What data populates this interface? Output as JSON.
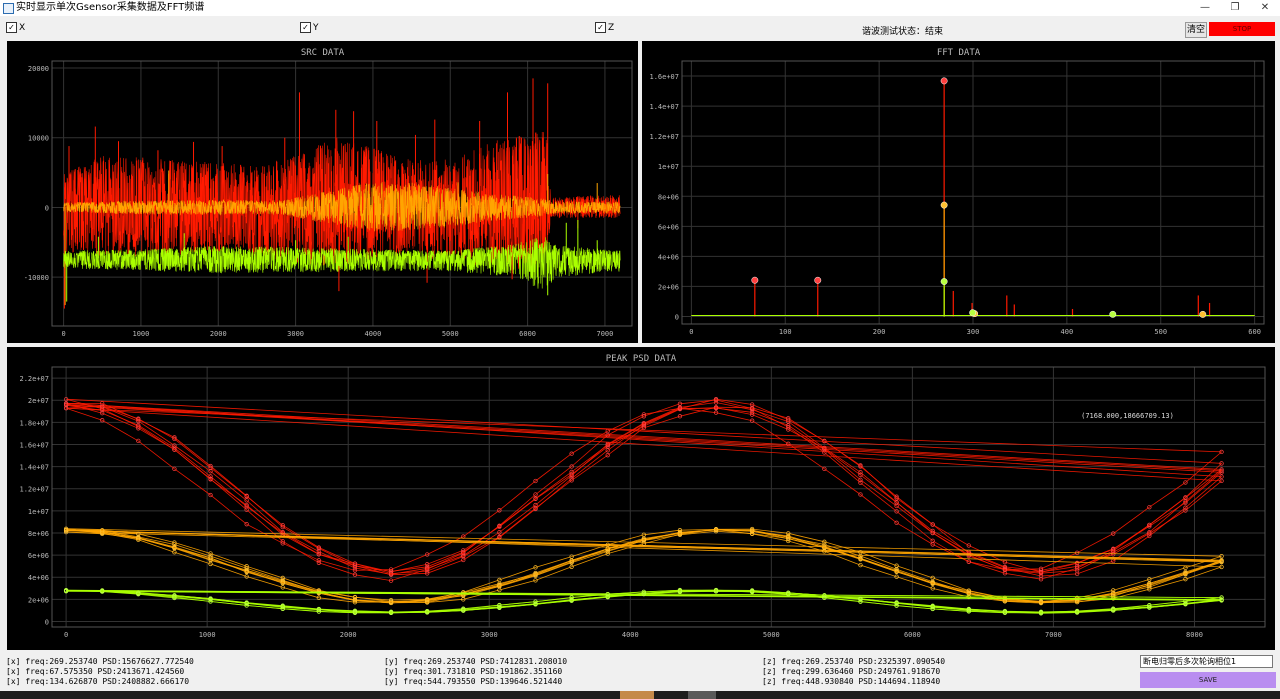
{
  "window": {
    "title": "实时显示单次Gsensor采集数据及FFT频谱"
  },
  "toolbar": {
    "checkboxes": [
      {
        "label": "X",
        "checked": true
      },
      {
        "label": "Y",
        "checked": true
      },
      {
        "label": "Z",
        "checked": true
      }
    ],
    "check_mark": "✓",
    "status_text": "谐波测试状态：结束",
    "clear_label": "清空",
    "stop_label": "STOP"
  },
  "colors": {
    "x": "#ff1a00",
    "y": "#ffa500",
    "z": "#aaff00",
    "panel_bg": "#000000",
    "grid": "#333333",
    "axis_text": "#bbbbbb",
    "x_marker": "#ff4040",
    "y_marker": "#ffc030",
    "z_marker": "#b8ff40",
    "stop": "#ff0000",
    "save": "#b98ef0"
  },
  "chart_data": [
    {
      "id": "src",
      "type": "line",
      "title": "SRC DATA",
      "xlim": [
        -150,
        7350
      ],
      "ylim": [
        -17000,
        21000
      ],
      "xticks": [
        0,
        1000,
        2000,
        3000,
        4000,
        5000,
        6000,
        7000
      ],
      "yticks": [
        -10000,
        0,
        10000,
        20000
      ],
      "ytick_labels": [
        "-10000",
        "0",
        "10000",
        "20000"
      ],
      "n_samples": 7200,
      "series": [
        {
          "key": "x",
          "center": 0,
          "cut_x": 6250,
          "upper_profile": [
            [
              0,
              4800
            ],
            [
              500,
              7500
            ],
            [
              1000,
              7200
            ],
            [
              1500,
              6800
            ],
            [
              2000,
              6400
            ],
            [
              2500,
              6000
            ],
            [
              3000,
              7400
            ],
            [
              3500,
              10200
            ],
            [
              4000,
              8600
            ],
            [
              4500,
              6800
            ],
            [
              5000,
              7000
            ],
            [
              5500,
              9300
            ],
            [
              6000,
              10800
            ],
            [
              6250,
              11200
            ],
            [
              6300,
              1500
            ],
            [
              7200,
              1800
            ]
          ],
          "lower_profile": [
            [
              0,
              -6500
            ],
            [
              500,
              -7000
            ],
            [
              1000,
              -7000
            ],
            [
              1500,
              -6800
            ],
            [
              2000,
              -6500
            ],
            [
              2500,
              -7000
            ],
            [
              3000,
              -8000
            ],
            [
              3500,
              -8500
            ],
            [
              4000,
              -7500
            ],
            [
              4500,
              -7200
            ],
            [
              5000,
              -7800
            ],
            [
              5500,
              -8500
            ],
            [
              6000,
              -9000
            ],
            [
              6250,
              -7000
            ],
            [
              6300,
              -1500
            ],
            [
              7200,
              -1500
            ]
          ],
          "spikes": [
            [
              10,
              -14500
            ],
            [
              70,
              8800
            ],
            [
              150,
              5500
            ],
            [
              410,
              11600
            ],
            [
              710,
              9500
            ],
            [
              1220,
              8200
            ],
            [
              1680,
              9400
            ],
            [
              2050,
              8800
            ],
            [
              2860,
              10000
            ],
            [
              3050,
              16500
            ],
            [
              3520,
              14000
            ],
            [
              3750,
              13800
            ],
            [
              4050,
              12400
            ],
            [
              4550,
              10400
            ],
            [
              4800,
              12600
            ],
            [
              5380,
              12400
            ],
            [
              5600,
              9200
            ],
            [
              5740,
              16500
            ],
            [
              5920,
              10000
            ],
            [
              6070,
              18500
            ],
            [
              6260,
              17800
            ],
            [
              6650,
              -3000
            ],
            [
              3560,
              -12000
            ],
            [
              4700,
              -10800
            ],
            [
              5800,
              -10300
            ]
          ]
        },
        {
          "key": "y",
          "center": 0,
          "upper_profile": [
            [
              0,
              700
            ],
            [
              1000,
              1000
            ],
            [
              2000,
              1100
            ],
            [
              2800,
              1000
            ],
            [
              3500,
              2600
            ],
            [
              4000,
              3700
            ],
            [
              4500,
              3600
            ],
            [
              5000,
              2900
            ],
            [
              5500,
              2000
            ],
            [
              6000,
              1500
            ],
            [
              6250,
              1200
            ],
            [
              6300,
              900
            ],
            [
              7200,
              800
            ]
          ],
          "lower_profile": [
            [
              0,
              -700
            ],
            [
              1000,
              -1000
            ],
            [
              2000,
              -1100
            ],
            [
              2800,
              -1000
            ],
            [
              3500,
              -2500
            ],
            [
              4000,
              -3500
            ],
            [
              4500,
              -3400
            ],
            [
              5000,
              -2800
            ],
            [
              5500,
              -2000
            ],
            [
              6000,
              -1500
            ],
            [
              6250,
              -1200
            ],
            [
              6300,
              -900
            ],
            [
              7200,
              -800
            ]
          ],
          "spikes": [
            [
              20,
              -14000
            ],
            [
              1360,
              5300
            ],
            [
              5100,
              3600
            ],
            [
              6900,
              3500
            ],
            [
              6260,
              4800
            ]
          ]
        },
        {
          "key": "z",
          "center": -7300,
          "upper_profile": [
            [
              0,
              -6200
            ],
            [
              1000,
              -6000
            ],
            [
              2000,
              -5500
            ],
            [
              3000,
              -5700
            ],
            [
              4000,
              -6000
            ],
            [
              5000,
              -6200
            ],
            [
              5800,
              -5300
            ],
            [
              6200,
              -4000
            ],
            [
              6400,
              -5400
            ],
            [
              7200,
              -6200
            ]
          ],
          "lower_profile": [
            [
              0,
              -8800
            ],
            [
              1000,
              -9000
            ],
            [
              2000,
              -9500
            ],
            [
              3000,
              -9300
            ],
            [
              4000,
              -9200
            ],
            [
              5000,
              -9100
            ],
            [
              5800,
              -10000
            ],
            [
              6200,
              -12000
            ],
            [
              6400,
              -10000
            ],
            [
              7200,
              -9200
            ]
          ],
          "spikes": [
            [
              40,
              -13500
            ],
            [
              450,
              -4200
            ],
            [
              1560,
              -3700
            ],
            [
              3000,
              -4700
            ],
            [
              3680,
              -4200
            ],
            [
              6260,
              -12600
            ],
            [
              6500,
              -2200
            ],
            [
              6650,
              -1800
            ],
            [
              6900,
              -4700
            ]
          ]
        }
      ]
    },
    {
      "id": "fft",
      "type": "line",
      "title": "FFT DATA",
      "xlim": [
        -10,
        610
      ],
      "ylim": [
        -500000,
        17000000
      ],
      "xticks": [
        0,
        100,
        200,
        300,
        400,
        500,
        600
      ],
      "yticks": [
        0,
        2000000,
        4000000,
        6000000,
        8000000,
        10000000,
        12000000,
        14000000,
        16000000
      ],
      "ytick_labels": [
        "0",
        "2e+06",
        "4e+06",
        "6e+06",
        "8e+06",
        "1e+07",
        "1.2e+07",
        "1.4e+07",
        "1.6e+07"
      ],
      "series": [
        {
          "key": "x",
          "lines": [
            [
              67.58,
              2413671
            ],
            [
              134.63,
              2408882
            ],
            [
              269.25,
              15676628
            ],
            [
              279,
              1700000
            ],
            [
              299,
              900000
            ],
            [
              336,
              1400000
            ],
            [
              344,
              800000
            ],
            [
              406,
              500000
            ],
            [
              540,
              1400000
            ],
            [
              552,
              900000
            ]
          ]
        },
        {
          "key": "y",
          "lines": [
            [
              269.25,
              7412831
            ],
            [
              301.73,
              191862
            ],
            [
              544.79,
              139646
            ]
          ]
        },
        {
          "key": "z",
          "lines": [
            [
              269.25,
              2325397
            ],
            [
              299.64,
              249762
            ],
            [
              448.93,
              144694
            ]
          ]
        }
      ],
      "markers": [
        {
          "key": "x",
          "x": 67.58,
          "y": 2413671
        },
        {
          "key": "x",
          "x": 134.63,
          "y": 2408882
        },
        {
          "key": "x",
          "x": 269.25,
          "y": 15676628
        },
        {
          "key": "y",
          "x": 269.25,
          "y": 7412831
        },
        {
          "key": "y",
          "x": 301.73,
          "y": 191862
        },
        {
          "key": "y",
          "x": 544.79,
          "y": 139646
        },
        {
          "key": "z",
          "x": 269.25,
          "y": 2325397
        },
        {
          "key": "z",
          "x": 299.64,
          "y": 249762
        },
        {
          "key": "z",
          "x": 448.93,
          "y": 144694
        }
      ]
    },
    {
      "id": "peak",
      "type": "line",
      "title": "PEAK PSD DATA",
      "xlim": [
        -100,
        8500
      ],
      "ylim": [
        -500000,
        23000000
      ],
      "xticks": [
        0,
        1000,
        2000,
        3000,
        4000,
        5000,
        6000,
        7000,
        8000
      ],
      "yticks": [
        0,
        2000000,
        4000000,
        6000000,
        8000000,
        10000000,
        12000000,
        14000000,
        16000000,
        18000000,
        20000000,
        22000000
      ],
      "ytick_labels": [
        "0",
        "2e+06",
        "4e+06",
        "6e+06",
        "8e+06",
        "1e+07",
        "1.2e+07",
        "1.4e+07",
        "1.6e+07",
        "1.8e+07",
        "2e+07",
        "2.2e+07"
      ],
      "annotation": {
        "text": "(7168.000,18666709.13)",
        "x": 7168,
        "y": 18666709
      },
      "x_step": 256,
      "series": [
        {
          "key": "x",
          "mean": 12000000,
          "amp": 7800000,
          "period": 4600,
          "phase": 0,
          "n_traces": 7
        },
        {
          "key": "y",
          "mean": 5000000,
          "amp": 3300000,
          "period": 4600,
          "phase": 0,
          "n_traces": 7
        },
        {
          "key": "z",
          "mean": 1800000,
          "amp": 1000000,
          "period": 4600,
          "phase": 0,
          "n_traces": 7
        }
      ]
    }
  ],
  "log": {
    "x_lines": [
      "[x] freq:269.253740 PSD:15676627.772540",
      "[x] freq:67.575350 PSD:2413671.424560",
      "[x] freq:134.626870 PSD:2408882.666170"
    ],
    "y_lines": [
      "[y] freq:269.253740 PSD:7412831.208010",
      "[y] freq:301.731810 PSD:191862.351160",
      "[y] freq:544.793550 PSD:139646.521440"
    ],
    "z_lines": [
      "[z] freq:269.253740 PSD:2325397.090540",
      "[z] freq:299.636460 PSD:249761.918670",
      "[z] freq:448.930840 PSD:144694.118940"
    ]
  },
  "save_panel": {
    "name_value": "断电归零后多次轮询相位1",
    "save_label": "SAVE"
  }
}
